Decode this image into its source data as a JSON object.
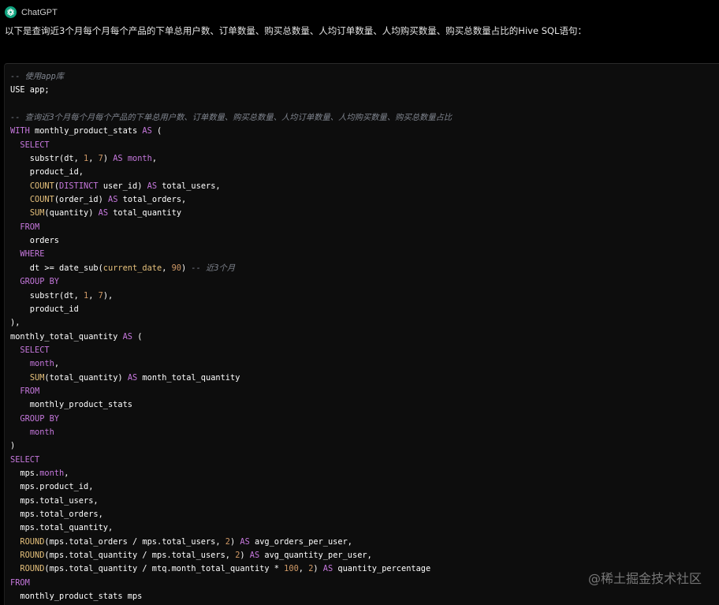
{
  "header": {
    "sender": "ChatGPT",
    "avatar_icon": "openai-logo-icon",
    "avatar_color": "#10a37f"
  },
  "message": {
    "intro": "以下是查询近3个月每个月每个产品的下单总用户数、订单数量、购买总数量、人均订单数量、人均购买数量、购买总数量占比的Hive SQL语句："
  },
  "code": {
    "language": "sql",
    "colors": {
      "keyword": "#c678dd",
      "function": "#e5c07b",
      "number": "#d19a66",
      "comment": "#7f848e",
      "text": "#ffffff",
      "background": "#0d0d0d"
    },
    "lines": [
      [
        [
          "cm",
          "-- 使用app库"
        ]
      ],
      [
        [
          "",
          "USE app;"
        ]
      ],
      [
        [
          "",
          ""
        ]
      ],
      [
        [
          "cm",
          "-- 查询近3个月每个月每个产品的下单总用户数、订单数量、购买总数量、人均订单数量、人均购买数量、购买总数量占比"
        ]
      ],
      [
        [
          "kw",
          "WITH"
        ],
        [
          "",
          " monthly_product_stats "
        ],
        [
          "kw",
          "AS"
        ],
        [
          "",
          " ("
        ]
      ],
      [
        [
          "",
          "  "
        ],
        [
          "kw",
          "SELECT"
        ]
      ],
      [
        [
          "",
          "    substr(dt, "
        ],
        [
          "num",
          "1"
        ],
        [
          "",
          ", "
        ],
        [
          "num",
          "7"
        ],
        [
          "",
          ") "
        ],
        [
          "kw",
          "AS"
        ],
        [
          "",
          " "
        ],
        [
          "kw",
          "month"
        ],
        [
          "",
          ","
        ]
      ],
      [
        [
          "",
          "    product_id,"
        ]
      ],
      [
        [
          "",
          "    "
        ],
        [
          "fn",
          "COUNT"
        ],
        [
          "",
          "("
        ],
        [
          "kw",
          "DISTINCT"
        ],
        [
          "",
          " user_id) "
        ],
        [
          "kw",
          "AS"
        ],
        [
          "",
          " total_users,"
        ]
      ],
      [
        [
          "",
          "    "
        ],
        [
          "fn",
          "COUNT"
        ],
        [
          "",
          "(order_id) "
        ],
        [
          "kw",
          "AS"
        ],
        [
          "",
          " total_orders,"
        ]
      ],
      [
        [
          "",
          "    "
        ],
        [
          "fn",
          "SUM"
        ],
        [
          "",
          "(quantity) "
        ],
        [
          "kw",
          "AS"
        ],
        [
          "",
          " total_quantity"
        ]
      ],
      [
        [
          "",
          "  "
        ],
        [
          "kw",
          "FROM"
        ]
      ],
      [
        [
          "",
          "    orders"
        ]
      ],
      [
        [
          "",
          "  "
        ],
        [
          "kw",
          "WHERE"
        ]
      ],
      [
        [
          "",
          "    dt >= date_sub("
        ],
        [
          "fn",
          "current_date"
        ],
        [
          "",
          ", "
        ],
        [
          "num",
          "90"
        ],
        [
          "",
          ") "
        ],
        [
          "cm",
          "-- 近3个月"
        ]
      ],
      [
        [
          "",
          "  "
        ],
        [
          "kw",
          "GROUP BY"
        ]
      ],
      [
        [
          "",
          "    substr(dt, "
        ],
        [
          "num",
          "1"
        ],
        [
          "",
          ", "
        ],
        [
          "num",
          "7"
        ],
        [
          "",
          "),"
        ]
      ],
      [
        [
          "",
          "    product_id"
        ]
      ],
      [
        [
          "",
          "),"
        ]
      ],
      [
        [
          "",
          "monthly_total_quantity "
        ],
        [
          "kw",
          "AS"
        ],
        [
          "",
          " ("
        ]
      ],
      [
        [
          "",
          "  "
        ],
        [
          "kw",
          "SELECT"
        ]
      ],
      [
        [
          "",
          "    "
        ],
        [
          "kw",
          "month"
        ],
        [
          "",
          ","
        ]
      ],
      [
        [
          "",
          "    "
        ],
        [
          "fn",
          "SUM"
        ],
        [
          "",
          "(total_quantity) "
        ],
        [
          "kw",
          "AS"
        ],
        [
          "",
          " month_total_quantity"
        ]
      ],
      [
        [
          "",
          "  "
        ],
        [
          "kw",
          "FROM"
        ]
      ],
      [
        [
          "",
          "    monthly_product_stats"
        ]
      ],
      [
        [
          "",
          "  "
        ],
        [
          "kw",
          "GROUP BY"
        ]
      ],
      [
        [
          "",
          "    "
        ],
        [
          "kw",
          "month"
        ]
      ],
      [
        [
          "",
          ")"
        ]
      ],
      [
        [
          "kw",
          "SELECT"
        ]
      ],
      [
        [
          "",
          "  mps."
        ],
        [
          "kw",
          "month"
        ],
        [
          "",
          ","
        ]
      ],
      [
        [
          "",
          "  mps.product_id,"
        ]
      ],
      [
        [
          "",
          "  mps.total_users,"
        ]
      ],
      [
        [
          "",
          "  mps.total_orders,"
        ]
      ],
      [
        [
          "",
          "  mps.total_quantity,"
        ]
      ],
      [
        [
          "",
          "  "
        ],
        [
          "fn",
          "ROUND"
        ],
        [
          "",
          "(mps.total_orders / mps.total_users, "
        ],
        [
          "num",
          "2"
        ],
        [
          "",
          ") "
        ],
        [
          "kw",
          "AS"
        ],
        [
          "",
          " avg_orders_per_user,"
        ]
      ],
      [
        [
          "",
          "  "
        ],
        [
          "fn",
          "ROUND"
        ],
        [
          "",
          "(mps.total_quantity / mps.total_users, "
        ],
        [
          "num",
          "2"
        ],
        [
          "",
          ") "
        ],
        [
          "kw",
          "AS"
        ],
        [
          "",
          " avg_quantity_per_user,"
        ]
      ],
      [
        [
          "",
          "  "
        ],
        [
          "fn",
          "ROUND"
        ],
        [
          "",
          "(mps.total_quantity / mtq.month_total_quantity * "
        ],
        [
          "num",
          "100"
        ],
        [
          "",
          ", "
        ],
        [
          "num",
          "2"
        ],
        [
          "",
          ") "
        ],
        [
          "kw",
          "AS"
        ],
        [
          "",
          " quantity_percentage"
        ]
      ],
      [
        [
          "kw",
          "FROM"
        ]
      ],
      [
        [
          "",
          "  monthly_product_stats mps"
        ]
      ]
    ]
  },
  "watermark": "@稀土掘金技术社区"
}
